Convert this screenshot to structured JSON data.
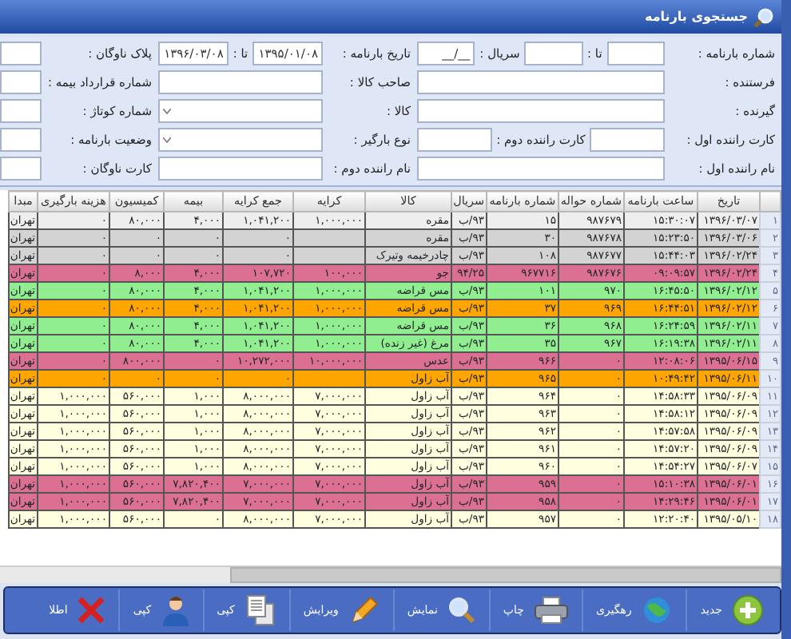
{
  "window": {
    "title": "جستجوی بارنامه"
  },
  "form": {
    "rows": [
      {
        "groups": [
          {
            "items": [
              {
                "kind": "label",
                "text": "شماره بارنامه :"
              },
              {
                "kind": "input"
              },
              {
                "kind": "label",
                "text": "تا :"
              },
              {
                "kind": "input"
              },
              {
                "kind": "label",
                "text": "سریال :"
              },
              {
                "kind": "input",
                "value": "__/__"
              }
            ]
          },
          {
            "items": [
              {
                "kind": "label",
                "text": "تاریخ بارنامه :"
              },
              {
                "kind": "input",
                "value": "۱۳۹۵/۰۱/۰۸"
              },
              {
                "kind": "label",
                "text": "تا :"
              },
              {
                "kind": "input",
                "value": "۱۳۹۶/۰۳/۰۸"
              }
            ]
          },
          {
            "items": [
              {
                "kind": "label",
                "text": "پلاک ناوگان :"
              },
              {
                "kind": "input"
              }
            ]
          }
        ]
      },
      {
        "groups": [
          {
            "items": [
              {
                "kind": "label",
                "text": "فرستنده :"
              },
              {
                "kind": "input"
              }
            ]
          },
          {
            "items": [
              {
                "kind": "label",
                "text": "صاحب کالا :"
              },
              {
                "kind": "input"
              }
            ]
          },
          {
            "items": [
              {
                "kind": "label",
                "text": "شماره قرارداد بیمه :"
              },
              {
                "kind": "input"
              }
            ]
          }
        ]
      },
      {
        "groups": [
          {
            "items": [
              {
                "kind": "label",
                "text": "گیرنده :"
              },
              {
                "kind": "input"
              }
            ]
          },
          {
            "items": [
              {
                "kind": "label",
                "text": "کالا :"
              },
              {
                "kind": "select"
              }
            ]
          },
          {
            "items": [
              {
                "kind": "label",
                "text": "شماره کوتاژ :"
              },
              {
                "kind": "input"
              }
            ]
          }
        ]
      },
      {
        "groups": [
          {
            "items": [
              {
                "kind": "label",
                "text": "کارت راننده اول :"
              },
              {
                "kind": "input"
              },
              {
                "kind": "label",
                "text": "کارت راننده دوم :"
              },
              {
                "kind": "input"
              }
            ]
          },
          {
            "items": [
              {
                "kind": "label",
                "text": "نوع بارگیر :"
              },
              {
                "kind": "select"
              }
            ]
          },
          {
            "items": [
              {
                "kind": "label",
                "text": "وضعیت بارنامه :"
              },
              {
                "kind": "input"
              }
            ]
          }
        ]
      },
      {
        "groups": [
          {
            "items": [
              {
                "kind": "label",
                "text": "نام راننده اول :"
              },
              {
                "kind": "input"
              }
            ]
          },
          {
            "items": [
              {
                "kind": "label",
                "text": "نام راننده دوم :"
              },
              {
                "kind": "input"
              }
            ]
          },
          {
            "items": [
              {
                "kind": "label",
                "text": "کارت ناوگان :"
              },
              {
                "kind": "input"
              }
            ]
          }
        ]
      }
    ]
  },
  "table": {
    "columns": [
      "تاریخ",
      "ساعت بارنامه",
      "شماره حواله",
      "شماره بارنامه",
      "سریال",
      "کالا",
      "کرایه",
      "جمع کرایه",
      "بیمه",
      "کمیسیون",
      "هزینه بارگیری",
      "مبدا"
    ],
    "rows": [
      {
        "number": "۱",
        "color": "#eeeeee",
        "cells": [
          "۱۳۹۶/۰۳/۰۷",
          "۱۵:۳۰:۰۷",
          "۹۸۷۶۷۹",
          "۱۵",
          "۹۳/ب",
          "مقره",
          "۱,۰۰۰,۰۰۰",
          "۱,۰۴۱,۲۰۰",
          "۴,۰۰۰",
          "۸۰,۰۰۰",
          "۰",
          "تهران"
        ]
      },
      {
        "number": "۲",
        "color": "#d3d3d3",
        "cells": [
          "۱۳۹۶/۰۳/۰۶",
          "۱۵:۲۳:۵۰",
          "۹۸۷۶۷۸",
          "۳۰",
          "۹۳/ب",
          "مقره",
          null,
          "۰",
          "۰",
          "۰",
          "۰",
          "تهران"
        ]
      },
      {
        "number": "۳",
        "color": "#d3d3d3",
        "cells": [
          "۱۳۹۶/۰۲/۲۴",
          "۱۵:۴۴:۰۳",
          "۹۸۷۶۷۷",
          "۱۰۸",
          "۹۳/ب",
          "چادرخیمه وتیرک",
          null,
          "۰",
          "۰",
          "۰",
          "۰",
          "تهران"
        ]
      },
      {
        "number": "۴",
        "color": "#db7093",
        "cells": [
          "۱۳۹۶/۰۲/۲۴",
          "۰۹:۰۹:۵۷",
          "۹۸۷۶۷۶",
          "۹۶۷۷۱۶",
          "۹۴/۲۵",
          "جو",
          "۱۰۰,۰۰۰",
          "۱۰۷,۷۲۰",
          "۴,۰۰۰",
          "۸,۰۰۰",
          "۰",
          "تهران"
        ]
      },
      {
        "number": "۵",
        "color": "#90ee90",
        "cells": [
          "۱۳۹۶/۰۲/۱۲",
          "۱۶:۴۵:۵۰",
          "۹۷۰",
          "۱۰۱",
          "۹۳/ب",
          "مس قراضه",
          "۱,۰۰۰,۰۰۰",
          "۱,۰۴۱,۲۰۰",
          "۴,۰۰۰",
          "۸۰,۰۰۰",
          "۰",
          "تهران"
        ]
      },
      {
        "number": "۶",
        "color": "#ffa500",
        "cells": [
          "۱۳۹۶/۰۲/۱۲",
          "۱۶:۴۴:۵۱",
          "۹۶۹",
          "۳۷",
          "۹۳/ب",
          "مس قراضه",
          "۱,۰۰۰,۰۰۰",
          "۱,۰۴۱,۲۰۰",
          "۴,۰۰۰",
          "۸۰,۰۰۰",
          "۰",
          "تهران"
        ]
      },
      {
        "number": "۷",
        "color": "#90ee90",
        "cells": [
          "۱۳۹۶/۰۲/۱۱",
          "۱۶:۲۴:۵۹",
          "۹۶۸",
          "۳۶",
          "۹۳/ب",
          "مس قراضه",
          "۱,۰۰۰,۰۰۰",
          "۱,۰۴۱,۲۰۰",
          "۴,۰۰۰",
          "۸۰,۰۰۰",
          "۰",
          "تهران"
        ]
      },
      {
        "number": "۸",
        "color": "#90ee90",
        "cells": [
          "۱۳۹۶/۰۲/۱۱",
          "۱۶:۱۹:۳۸",
          "۹۶۷",
          "۳۵",
          "۹۳/ب",
          "مرغ (غیر زنده)",
          "۱,۰۰۰,۰۰۰",
          "۱,۰۴۱,۲۰۰",
          "۴,۰۰۰",
          "۸۰,۰۰۰",
          "۰",
          "تهران"
        ]
      },
      {
        "number": "۹",
        "color": "#db7093",
        "cells": [
          "۱۳۹۵/۰۶/۱۵",
          "۱۲:۰۸:۰۶",
          "۰",
          "۹۶۶",
          "۹۳/ب",
          "عدس",
          "۱۰,۰۰۰,۰۰۰",
          "۱۰,۲۷۲,۰۰۰",
          "۰",
          "۸۰۰,۰۰۰",
          "۰",
          "تهران"
        ]
      },
      {
        "number": "۱۰",
        "color": "#ffa500",
        "cells": [
          "۱۳۹۵/۰۶/۱۱",
          "۱۰:۴۹:۴۲",
          "۰",
          "۹۶۵",
          "۹۳/ب",
          "آب زاول",
          null,
          "۰",
          "۰",
          "۰",
          "۰",
          "تهران"
        ]
      },
      {
        "number": "۱۱",
        "color": "#ffffe0",
        "cells": [
          "۱۳۹۵/۰۶/۰۹",
          "۱۴:۵۸:۳۳",
          "۰",
          "۹۶۴",
          "۹۳/ب",
          "آب زاول",
          "۷,۰۰۰,۰۰۰",
          "۸,۰۰۰,۰۰۰",
          "۱,۰۰۰",
          "۵۶۰,۰۰۰",
          "۱,۰۰۰,۰۰۰",
          "تهران"
        ]
      },
      {
        "number": "۱۲",
        "color": "#ffffe0",
        "cells": [
          "۱۳۹۵/۰۶/۰۹",
          "۱۴:۵۸:۱۲",
          "۰",
          "۹۶۳",
          "۹۳/ب",
          "آب زاول",
          "۷,۰۰۰,۰۰۰",
          "۸,۰۰۰,۰۰۰",
          "۱,۰۰۰",
          "۵۶۰,۰۰۰",
          "۱,۰۰۰,۰۰۰",
          "تهران"
        ]
      },
      {
        "number": "۱۳",
        "color": "#ffffe0",
        "cells": [
          "۱۳۹۵/۰۶/۰۹",
          "۱۴:۵۷:۵۸",
          "۰",
          "۹۶۲",
          "۹۳/ب",
          "آب زاول",
          "۷,۰۰۰,۰۰۰",
          "۸,۰۰۰,۰۰۰",
          "۱,۰۰۰",
          "۵۶۰,۰۰۰",
          "۱,۰۰۰,۰۰۰",
          "تهران"
        ]
      },
      {
        "number": "۱۴",
        "color": "#ffffe0",
        "cells": [
          "۱۳۹۵/۰۶/۰۹",
          "۱۴:۵۷:۲۰",
          "۰",
          "۹۶۱",
          "۹۳/ب",
          "آب زاول",
          "۷,۰۰۰,۰۰۰",
          "۸,۰۰۰,۰۰۰",
          "۱,۰۰۰",
          "۵۶۰,۰۰۰",
          "۱,۰۰۰,۰۰۰",
          "تهران"
        ]
      },
      {
        "number": "۱۵",
        "color": "#ffffe0",
        "cells": [
          "۱۳۹۵/۰۶/۰۷",
          "۱۴:۵۴:۲۷",
          "۰",
          "۹۶۰",
          "۹۳/ب",
          "آب زاول",
          "۷,۰۰۰,۰۰۰",
          "۸,۰۰۰,۰۰۰",
          "۱,۰۰۰",
          "۵۶۰,۰۰۰",
          "۱,۰۰۰,۰۰۰",
          "تهران"
        ]
      },
      {
        "number": "۱۶",
        "color": "#db7093",
        "cells": [
          "۱۳۹۵/۰۶/۰۱",
          "۱۵:۱۰:۳۸",
          "۰",
          "۹۵۹",
          "۹۳/ب",
          "آب زاول",
          "۷,۰۰۰,۰۰۰",
          "۷,۰۰۰,۰۰۰",
          "۷,۸۲۰,۴۰۰",
          "۵۶۰,۰۰۰",
          "۱,۰۰۰,۰۰۰",
          "تهران"
        ]
      },
      {
        "number": "۱۷",
        "color": "#db7093",
        "cells": [
          "۱۳۹۵/۰۶/۰۱",
          "۱۴:۲۹:۴۶",
          "۰",
          "۹۵۸",
          "۹۳/ب",
          "آب زاول",
          "۷,۰۰۰,۰۰۰",
          "۷,۰۰۰,۰۰۰",
          "۷,۸۲۰,۴۰۰",
          "۵۶۰,۰۰۰",
          "۱,۰۰۰,۰۰۰",
          "تهران"
        ]
      },
      {
        "number": "۱۸",
        "color": "#ffffe0",
        "cells": [
          "۱۳۹۵/۰۵/۱۰",
          "۱۲:۲۰:۴۰",
          "۰",
          "۹۵۷",
          "۹۳/ب",
          "آب زاول",
          "۷,۰۰۰,۰۰۰",
          "۸,۰۰۰,۰۰۰",
          "۰",
          "۵۶۰,۰۰۰",
          "۱,۰۰۰,۰۰۰",
          "تهران"
        ]
      }
    ]
  },
  "toolbar": [
    {
      "label": "جدید"
    },
    {
      "label": "رهگیری"
    },
    {
      "label": "چاپ"
    },
    {
      "label": "نمایش"
    },
    {
      "label": "ویرایش"
    },
    {
      "label": "کپی"
    },
    {
      "label": "کپی"
    },
    {
      "label": "اطلا"
    }
  ]
}
